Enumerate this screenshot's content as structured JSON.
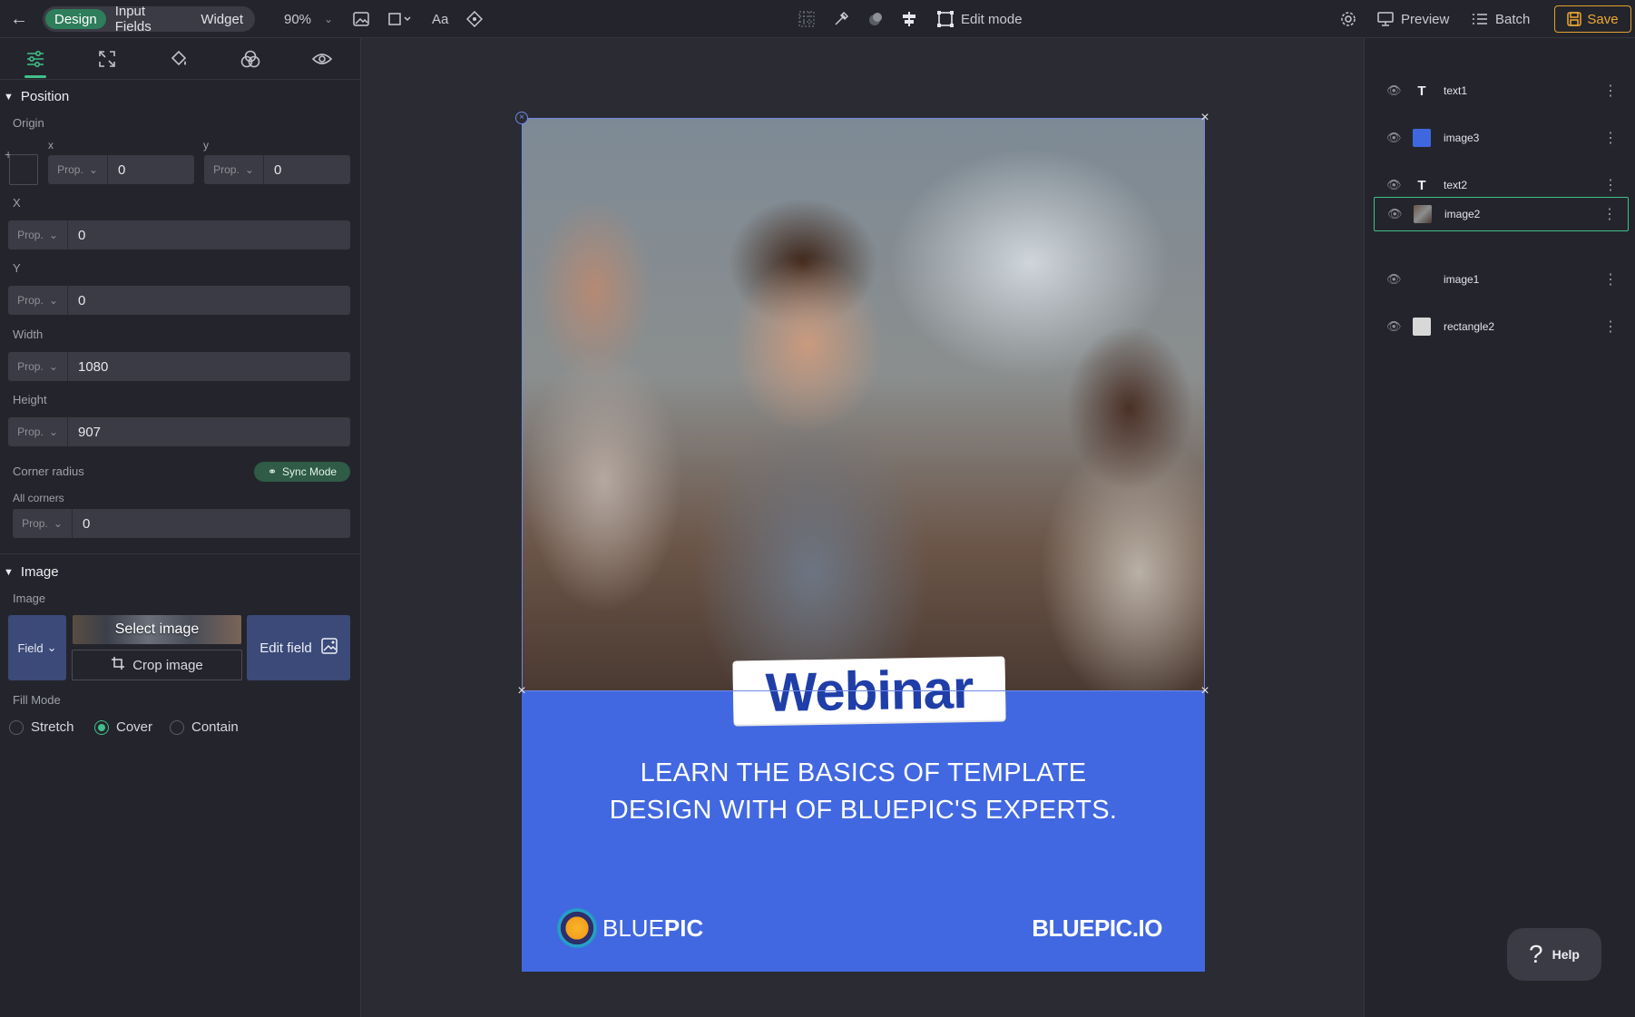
{
  "topbar": {
    "modes": [
      {
        "label": "Design",
        "active": true
      },
      {
        "label": "Input Fields",
        "active": false
      },
      {
        "label": "Widget",
        "active": false
      }
    ],
    "zoom": "90%",
    "font_tool": "Aa",
    "edit_mode_label": "Edit mode",
    "preview_label": "Preview",
    "batch_label": "Batch",
    "save_label": "Save",
    "accent_save": "#e3a02c"
  },
  "left_panel": {
    "position": {
      "title": "Position",
      "origin_label": "Origin",
      "origin_x_label": "x",
      "origin_y_label": "y",
      "origin_x": {
        "unit": "Prop.",
        "value": "0"
      },
      "origin_y": {
        "unit": "Prop.",
        "value": "0"
      },
      "x_label": "X",
      "x": {
        "unit": "Prop.",
        "value": "0"
      },
      "y_label": "Y",
      "y": {
        "unit": "Prop.",
        "value": "0"
      },
      "width_label": "Width",
      "width": {
        "unit": "Prop.",
        "value": "1080"
      },
      "height_label": "Height",
      "height": {
        "unit": "Prop.",
        "value": "907"
      },
      "corner_radius_label": "Corner radius",
      "sync_mode_label": "Sync Mode",
      "all_corners_label": "All corners",
      "corners": {
        "unit": "Prop.",
        "value": "0"
      }
    },
    "image": {
      "title": "Image",
      "image_label": "Image",
      "field_button": "Field",
      "select_image": "Select image",
      "crop_image": "Crop image",
      "edit_field": "Edit field",
      "fill_mode_label": "Fill Mode",
      "fill_modes": [
        {
          "label": "Stretch",
          "selected": false
        },
        {
          "label": "Cover",
          "selected": true
        },
        {
          "label": "Contain",
          "selected": false
        }
      ]
    }
  },
  "canvas": {
    "artboard_color": "#4168e0",
    "badge_text": "Webinar",
    "headline_line1": "LEARN THE BASICS OF TEMPLATE",
    "headline_line2": "DESIGN WITH OF BLUEPIC'S EXPERTS.",
    "brand_name_light": "BLUE",
    "brand_name_bold": "PIC",
    "brand_url": "BLUEPIC.IO"
  },
  "layers": [
    {
      "name": "text1",
      "type": "text",
      "selected": false
    },
    {
      "name": "image3",
      "type": "color",
      "swatch": "#3f68e0",
      "selected": false
    },
    {
      "name": "text2",
      "type": "text",
      "selected": false
    },
    {
      "name": "image2",
      "type": "photo",
      "selected": true
    },
    {
      "name": "image1",
      "type": "empty",
      "selected": false
    },
    {
      "name": "rectangle2",
      "type": "color",
      "swatch": "#d8d8d8",
      "selected": false
    }
  ],
  "help_label": "Help",
  "accent": "#3fc08a"
}
